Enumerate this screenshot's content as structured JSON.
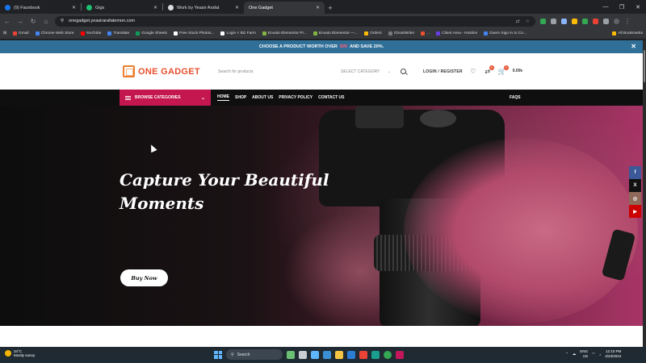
{
  "browser": {
    "tabs": [
      {
        "label": "(9) Facebook",
        "color": "#1877f2",
        "active": false
      },
      {
        "label": "Gigs",
        "color": "#1dbf73",
        "active": false
      },
      {
        "label": "Work by Yeasir Arafat",
        "color": "#dadce0",
        "active": false
      },
      {
        "label": "One Gadget",
        "color": "#e8512f",
        "active": true
      }
    ],
    "new_tab": "+",
    "url": "onegadget.yeasirarafatemon.com",
    "bookmarks": [
      "Gmail",
      "Chrome Web Store",
      "YouTube",
      "Translate",
      "Google Sheets",
      "Free Stock Photos...",
      "Login < Biz Farm",
      "Envato Elementor Pr...",
      "Envato Elementor —...",
      "Orders",
      "GhostWriter",
      "...",
      "Client Area - Hostinn",
      "Doem Sign in to Co..."
    ],
    "all_bookmarks": "All Bookmarks"
  },
  "site": {
    "promo": {
      "before": "CHOOSE A PRODUCT WORTH OVER",
      "highlight": "$99",
      "after": "AND SAVE 20%."
    },
    "logo": "ONE GADGET",
    "search": {
      "placeholder": "Search for products",
      "category": "SELECT CATEGORY"
    },
    "login": "LOGIN / REGISTER",
    "compare_count": "0",
    "cart_count": "0",
    "cart_total": "0.00৳",
    "browse": "BROWSE CATEGORIES",
    "menu": [
      "HOME",
      "SHOP",
      "ABOUT US",
      "PRIVACY POLICY",
      "CONTACT US"
    ],
    "faqs": "FAQS",
    "hero": {
      "title_line1": "Capture Your Beautiful",
      "title_line2": "Moments",
      "button": "Buy Now"
    },
    "social": [
      {
        "name": "facebook",
        "glyph": "f",
        "color": "#3b5998"
      },
      {
        "name": "x",
        "glyph": "X",
        "color": "#111111"
      },
      {
        "name": "instagram",
        "glyph": "◎",
        "color": "#8e6a5a"
      },
      {
        "name": "youtube",
        "glyph": "▶",
        "color": "#cc0000"
      }
    ]
  },
  "taskbar": {
    "weather_temp": "34°C",
    "weather_desc": "Mostly sunny",
    "search": "Search",
    "lang": "ENG",
    "region": "US",
    "time": "12:10 PM",
    "date": "4/23/2024"
  }
}
